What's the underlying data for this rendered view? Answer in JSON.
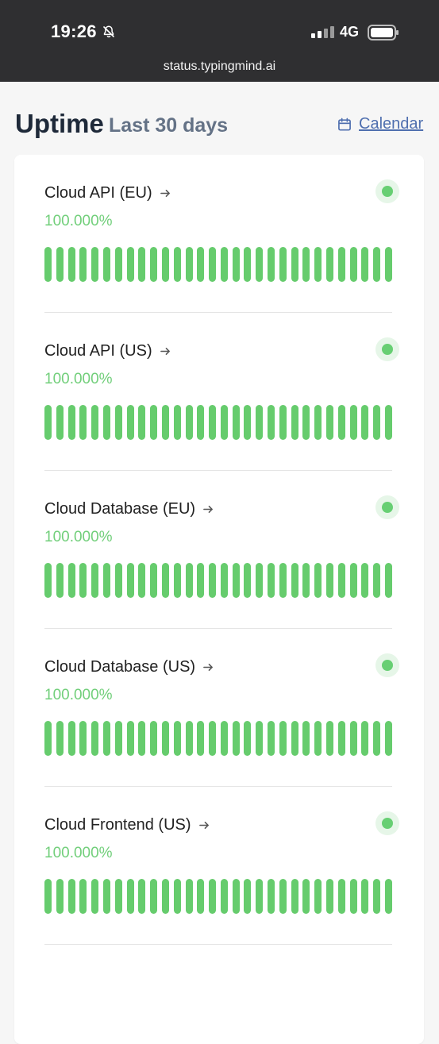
{
  "status_bar": {
    "time": "19:26",
    "network": "4G",
    "url": "status.typingmind.ai",
    "icons": [
      "bell-off-icon",
      "signal-icon",
      "battery-icon"
    ]
  },
  "header": {
    "title": "Uptime",
    "subtitle": "Last 30 days",
    "calendar_label": "Calendar"
  },
  "services": [
    {
      "name": "Cloud API (EU)",
      "uptime": "100.000%",
      "status": "up",
      "bar_count": 30
    },
    {
      "name": "Cloud API (US)",
      "uptime": "100.000%",
      "status": "up",
      "bar_count": 30
    },
    {
      "name": "Cloud Database (EU)",
      "uptime": "100.000%",
      "status": "up",
      "bar_count": 30
    },
    {
      "name": "Cloud Database (US)",
      "uptime": "100.000%",
      "status": "up",
      "bar_count": 30
    },
    {
      "name": "Cloud Frontend (US)",
      "uptime": "100.000%",
      "status": "up",
      "bar_count": 30
    }
  ],
  "colors": {
    "topbar": "#2f2f31",
    "title": "#1e2939",
    "subtitle": "#647286",
    "link": "#4f6faf",
    "uptime": "#72cf7b",
    "bar": "#66cc6d",
    "status_dot": "#67cf73"
  }
}
